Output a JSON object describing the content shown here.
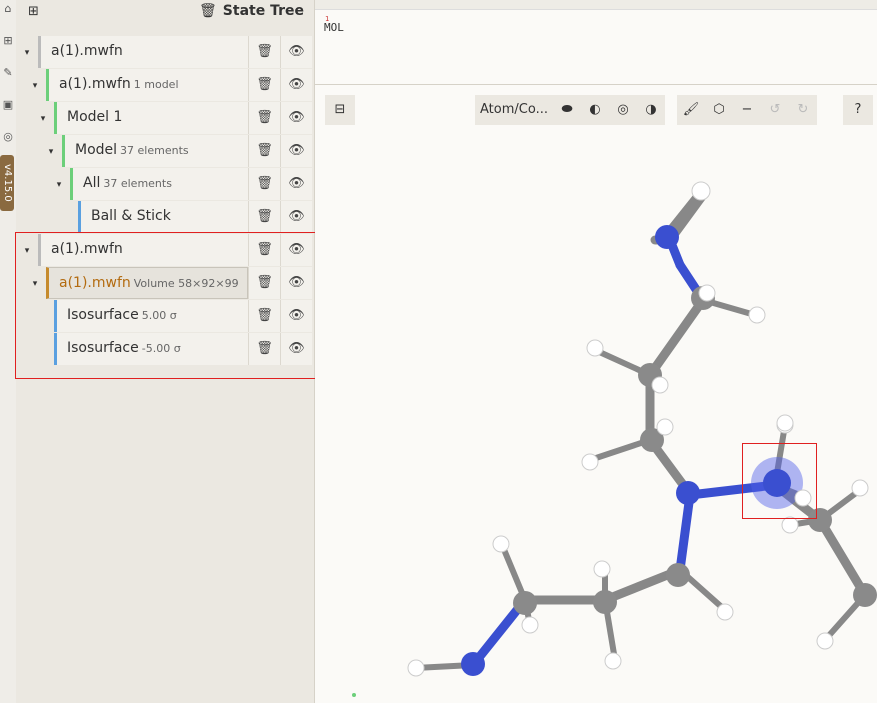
{
  "state_tree": {
    "title": "State Tree",
    "rows": [
      {
        "label": "a(1).mwfn",
        "sub": ""
      },
      {
        "label": "a(1).mwfn",
        "sub": "1 model"
      },
      {
        "label": "Model 1",
        "sub": ""
      },
      {
        "label": "Model",
        "sub": "37 elements"
      },
      {
        "label": "All",
        "sub": "37 elements"
      },
      {
        "label": "Ball & Stick",
        "sub": ""
      },
      {
        "label": "a(1).mwfn",
        "sub": ""
      },
      {
        "label": "a(1).mwfn",
        "sub": "Volume 58×92×99"
      },
      {
        "label": "Isosurface",
        "sub": "5.00 σ"
      },
      {
        "label": "Isosurface",
        "sub": "-5.00 σ"
      }
    ]
  },
  "sequence": {
    "index": "1",
    "residue": "MOL"
  },
  "version_badge": "v4.15.0",
  "toolbar": {
    "selection_mode": "Atom/Co..."
  },
  "colors": {
    "nitrogen": "#3a4fd0",
    "carbon": "#8a8a8a",
    "hydrogen": "#ffffff",
    "selected_accent": "#c68b2d",
    "highlight_box": "#e02020"
  }
}
